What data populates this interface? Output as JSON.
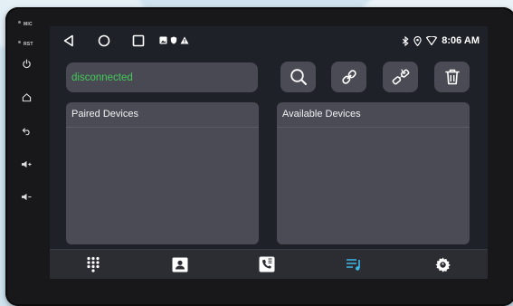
{
  "side_panel": {
    "mic_label": "MIC",
    "rst_label": "RST"
  },
  "statusbar": {
    "time": "8:06 AM"
  },
  "bluetooth": {
    "connection_status": "disconnected"
  },
  "panels": {
    "paired_title": "Paired Devices",
    "available_title": "Available Devices"
  },
  "colors": {
    "status_text": "#43c957",
    "active_nav": "#3fb6e8",
    "screen_bg": "#1f2129",
    "panel_bg": "#4a4b55"
  },
  "icons": {
    "nav": [
      "dialpad-icon",
      "contacts-icon",
      "call-log-icon",
      "music-icon",
      "settings-icon"
    ],
    "tools": [
      "search-icon",
      "link-icon",
      "unlink-icon",
      "trash-icon"
    ]
  }
}
